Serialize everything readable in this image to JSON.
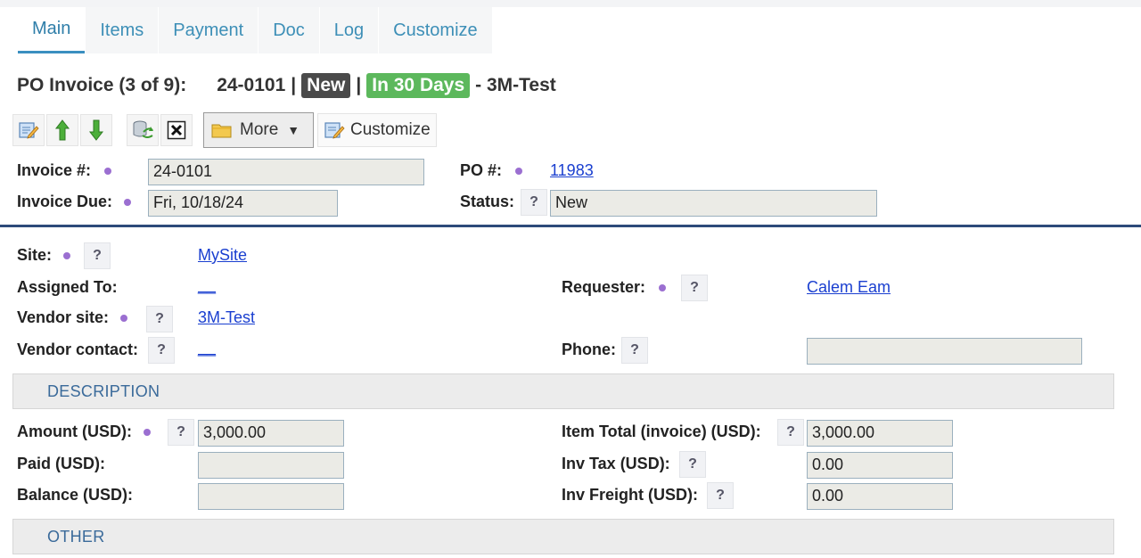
{
  "tabs": [
    "Main",
    "Items",
    "Payment",
    "Doc",
    "Log",
    "Customize"
  ],
  "title": {
    "prefix": "PO Invoice (3 of 9):",
    "number": "24-0101",
    "sep1": "|",
    "status_badge": "New",
    "sep2": "|",
    "due_badge": "In 30 Days",
    "vendor": "- 3M-Test"
  },
  "toolbar": {
    "more_label": "More",
    "customize_label": "Customize"
  },
  "header": {
    "invoice_label": "Invoice #:",
    "invoice_value": "24-0101",
    "po_label": "PO #:",
    "po_value": "11983",
    "due_label": "Invoice Due:",
    "due_value": "Fri, 10/18/24",
    "status_label": "Status:",
    "status_value": "New"
  },
  "details": {
    "site_label": "Site:",
    "site_value": "MySite",
    "assigned_label": "Assigned To:",
    "assigned_value": "__",
    "requester_label": "Requester:",
    "requester_value": "Calem Eam",
    "vendor_site_label": "Vendor site:",
    "vendor_site_value": "3M-Test",
    "vendor_contact_label": "Vendor contact:",
    "vendor_contact_value": "__",
    "phone_label": "Phone:",
    "phone_value": ""
  },
  "sections": {
    "description": "DESCRIPTION",
    "other": "OTHER"
  },
  "amounts": {
    "amount_label": "Amount (USD):",
    "amount_value": "3,000.00",
    "paid_label": "Paid (USD):",
    "paid_value": "",
    "balance_label": "Balance (USD):",
    "balance_value": "",
    "item_total_label": "Item Total (invoice) (USD):",
    "item_total_value": "3,000.00",
    "tax_label": "Inv Tax (USD):",
    "tax_value": "0.00",
    "freight_label": "Inv Freight (USD):",
    "freight_value": "0.00"
  },
  "help_glyph": "?",
  "colors": {
    "accent": "#3d8fb7",
    "link": "#1a3fd0",
    "badge_green": "#5cb85c",
    "badge_dark": "#4a4a4a",
    "required_dot": "#9b6fd1"
  }
}
